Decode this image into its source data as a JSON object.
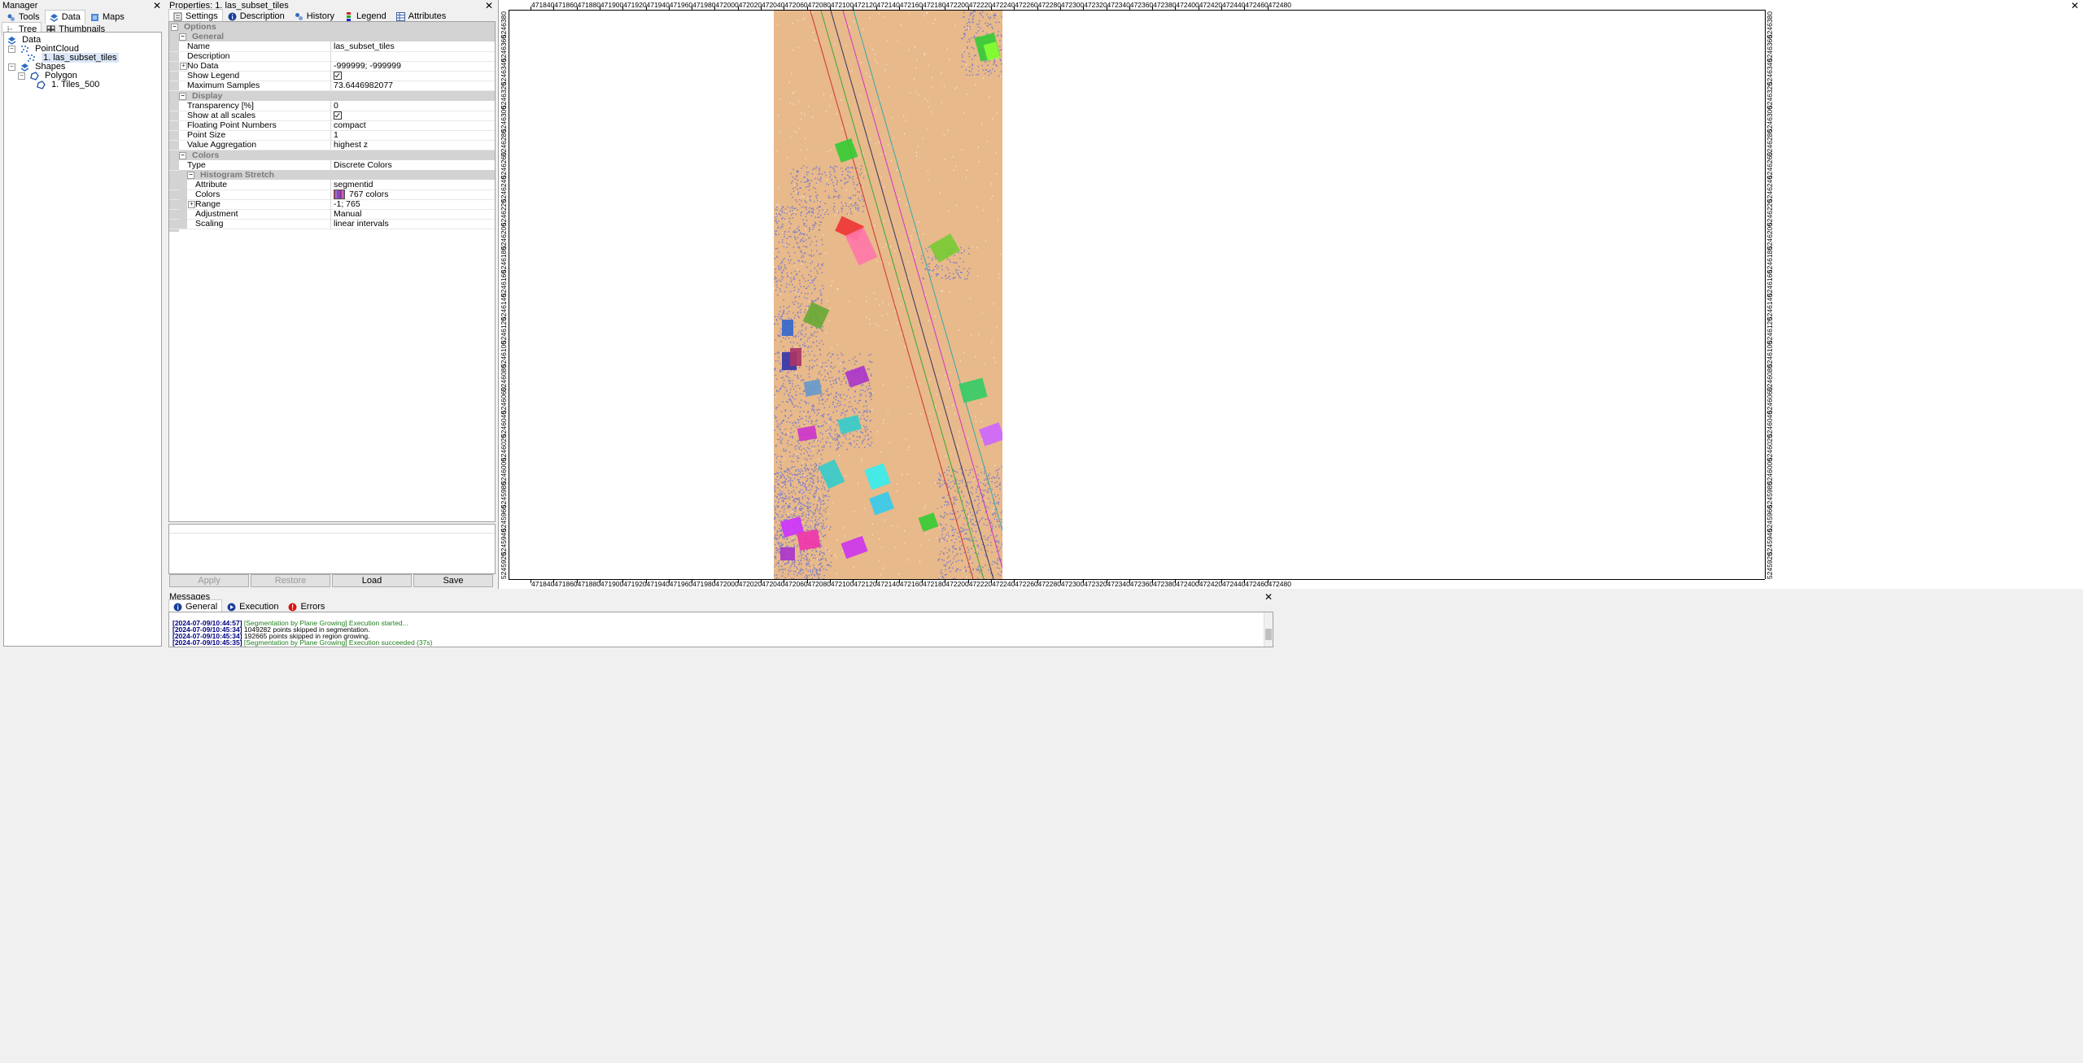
{
  "manager": {
    "title": "Manager",
    "tabs": [
      {
        "label": "Tools",
        "icon": "tools-icon"
      },
      {
        "label": "Data",
        "icon": "data-icon"
      },
      {
        "label": "Maps",
        "icon": "maps-icon"
      }
    ],
    "subtabs": [
      {
        "label": "Tree",
        "icon": "tree-icon"
      },
      {
        "label": "Thumbnails",
        "icon": "thumbnails-icon"
      }
    ],
    "tree": {
      "root": "Data",
      "pointcloud": "PointCloud",
      "pointcloud_item": "1. las_subset_tiles",
      "shapes": "Shapes",
      "polygon": "Polygon",
      "polygon_item": "1. Tiles_500"
    }
  },
  "properties": {
    "title": "Properties:  1. las_subset_tiles",
    "tabs": [
      {
        "label": "Settings",
        "icon": "settings-icon"
      },
      {
        "label": "Description",
        "icon": "info-icon"
      },
      {
        "label": "History",
        "icon": "history-icon"
      },
      {
        "label": "Legend",
        "icon": "legend-icon"
      },
      {
        "label": "Attributes",
        "icon": "attributes-icon"
      }
    ],
    "options_label": "Options",
    "general": {
      "label": "General",
      "name_k": "Name",
      "name_v": "las_subset_tiles",
      "desc_k": "Description",
      "desc_v": "",
      "nodata_k": "No Data",
      "nodata_v": "-999999; -999999",
      "legend_k": "Show Legend",
      "legend_v": true,
      "maxsamp_k": "Maximum Samples",
      "maxsamp_v": "73.6446982077"
    },
    "display": {
      "label": "Display",
      "transp_k": "Transparency [%]",
      "transp_v": "0",
      "allscales_k": "Show at all scales",
      "allscales_v": true,
      "float_k": "Floating Point Numbers",
      "float_v": "compact",
      "psize_k": "Point Size",
      "psize_v": "1",
      "agg_k": "Value Aggregation",
      "agg_v": "highest z"
    },
    "colors": {
      "label": "Colors",
      "type_k": "Type",
      "type_v": "Discrete Colors",
      "hist_label": "Histogram Stretch",
      "attr_k": "Attribute",
      "attr_v": "segmentid",
      "colors_k": "Colors",
      "colors_v": "767 colors",
      "range_k": "Range",
      "range_v": "-1; 765",
      "adj_k": "Adjustment",
      "adj_v": "Manual",
      "scal_k": "Scaling",
      "scal_v": "linear intervals"
    },
    "buttons": {
      "apply": "Apply",
      "restore": "Restore",
      "load": "Load",
      "save": "Save"
    }
  },
  "map": {
    "x_ticks": [
      "471840",
      "471860",
      "471880",
      "471900",
      "471920",
      "471940",
      "471960",
      "471980",
      "472000",
      "472020",
      "472040",
      "472060",
      "472080",
      "472100",
      "472120",
      "472140",
      "472160",
      "472180",
      "472200",
      "472220",
      "472240",
      "472260",
      "472280",
      "472300",
      "472320",
      "472340",
      "472360",
      "472380",
      "472400",
      "472420",
      "472440",
      "472460",
      "472480"
    ],
    "y_ticks": [
      "5246380",
      "5246360",
      "5246340",
      "5246320",
      "5246300",
      "5246280",
      "5246260",
      "5246240",
      "5246220",
      "5246200",
      "5246180",
      "5246160",
      "5246140",
      "5246120",
      "5246100",
      "5246080",
      "5246060",
      "5246040",
      "5246020",
      "5246000",
      "5245980",
      "5245960",
      "5245940",
      "5245920"
    ],
    "colors": {
      "ground": "#e8b98a",
      "veg": "#7f7fc8",
      "bg": "#ffffff"
    }
  },
  "messages": {
    "title": "Messages",
    "tabs": [
      {
        "label": "General",
        "icon": "info-icon"
      },
      {
        "label": "Execution",
        "icon": "execution-icon"
      },
      {
        "label": "Errors",
        "icon": "error-icon"
      }
    ],
    "lines": [
      {
        "ts": "[2024-07-09/10:44:57]",
        "text": "[Segmentation by Plane Growing] Execution started...",
        "ok": true
      },
      {
        "ts": "[2024-07-09/10:45:34]",
        "text": "1049282 points skipped in segmentation.",
        "ok": false
      },
      {
        "ts": "[2024-07-09/10:45:34]",
        "text": "192665 points skipped in region growing.",
        "ok": false
      },
      {
        "ts": "[2024-07-09/10:45:35]",
        "text": "[Segmentation by Plane Growing] Execution succeeded (37s)",
        "ok": true
      }
    ]
  }
}
